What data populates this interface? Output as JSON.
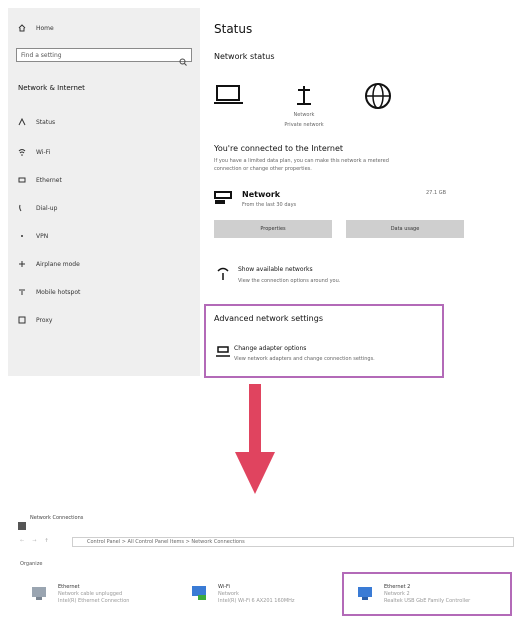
{
  "settings": {
    "sidebar": {
      "home_label": "Home",
      "search_placeholder": "Find a setting",
      "section_title": "Network & Internet",
      "items": [
        {
          "label": "Status",
          "icon": "status-icon"
        },
        {
          "label": "Wi-Fi",
          "icon": "wifi-icon"
        },
        {
          "label": "Ethernet",
          "icon": "ethernet-icon"
        },
        {
          "label": "Dial-up",
          "icon": "dialup-icon"
        },
        {
          "label": "VPN",
          "icon": "vpn-icon"
        },
        {
          "label": "Airplane mode",
          "icon": "airplane-icon"
        },
        {
          "label": "Mobile hotspot",
          "icon": "hotspot-icon"
        },
        {
          "label": "Proxy",
          "icon": "proxy-icon"
        }
      ]
    },
    "main": {
      "page_title": "Status",
      "network_status_heading": "Network status",
      "router_caption_line1": "Network",
      "router_caption_line2": "Private network",
      "connected_heading": "You're connected to the Internet",
      "connected_desc_line1": "If you have a limited data plan, you can make this network a metered",
      "connected_desc_line2": "connection or change other properties.",
      "network_name": "Network",
      "network_sub": "From the last 30 days",
      "network_usage": "27.1 GB",
      "properties_button": "Properties",
      "data_usage_button": "Data usage",
      "show_networks_title": "Show available networks",
      "show_networks_desc": "View the connection options around you.",
      "advanced_heading": "Advanced network settings",
      "change_adapter_title": "Change adapter options",
      "change_adapter_desc": "View network adapters and change connection settings."
    }
  },
  "connections_window": {
    "title": "Network Connections",
    "breadcrumb": "Control Panel  >  All Control Panel Items  >  Network Connections",
    "organize_label": "Organize",
    "adapters": [
      {
        "name": "Ethernet",
        "status": "Network cable unplugged",
        "device": "Intel(R) Ethernet Connection"
      },
      {
        "name": "Wi-Fi",
        "status": "Network",
        "device": "Intel(R) Wi-Fi 6 AX201 160MHz"
      },
      {
        "name": "Ethernet 2",
        "status": "Network 2",
        "device": "Realtek USB GbE Family Controller"
      }
    ]
  },
  "colors": {
    "highlight": "#b36ab8",
    "arrow": "#e0445f",
    "sidebar_bg": "#efefef",
    "button_bg": "#cfcfcf"
  }
}
